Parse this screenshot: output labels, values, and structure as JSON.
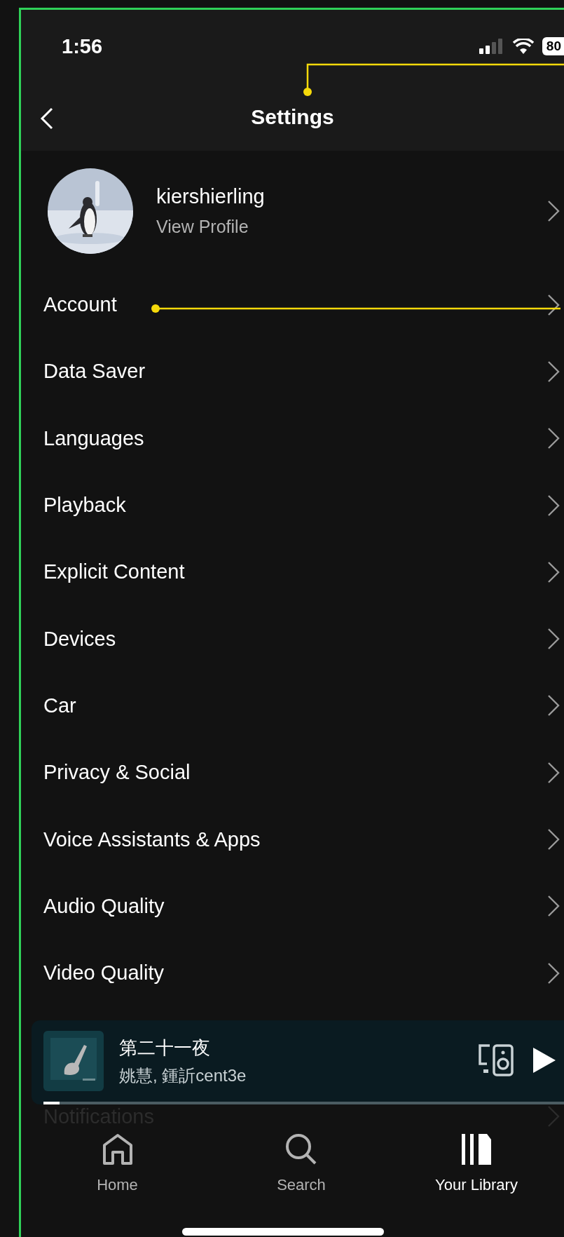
{
  "status_bar": {
    "time": "1:56",
    "battery": "80"
  },
  "header": {
    "title": "Settings"
  },
  "profile": {
    "name": "kiershierling",
    "subtitle": "View Profile"
  },
  "settings_items": [
    {
      "label": "Account"
    },
    {
      "label": "Data Saver"
    },
    {
      "label": "Languages"
    },
    {
      "label": "Playback"
    },
    {
      "label": "Explicit Content"
    },
    {
      "label": "Devices"
    },
    {
      "label": "Car"
    },
    {
      "label": "Privacy & Social"
    },
    {
      "label": "Voice Assistants & Apps"
    },
    {
      "label": "Audio Quality"
    },
    {
      "label": "Video Quality"
    }
  ],
  "now_playing": {
    "title": "第二十一夜",
    "artist": "姚慧, 鍾訢cent3e",
    "level": 0.03
  },
  "partly_hidden_item": {
    "label": "Notifications"
  },
  "nav_tabs": [
    {
      "label": "Home",
      "selected": false
    },
    {
      "label": "Search",
      "selected": false
    },
    {
      "label": "Your Library",
      "selected": true
    }
  ]
}
